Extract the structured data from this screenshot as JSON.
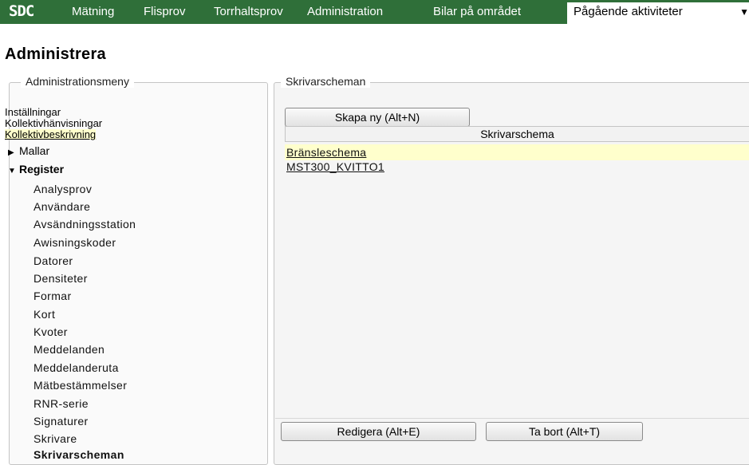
{
  "app": {
    "logo": "SDC"
  },
  "nav": {
    "items": [
      "Mätning",
      "Flisprov",
      "Torrhaltsprov",
      "Administration",
      "Bilar på området"
    ],
    "active": "Pågående aktiviteter"
  },
  "page": {
    "title": "Administrera"
  },
  "left": {
    "legend": "Administrationsmeny",
    "top_items": [
      "Inställningar",
      "Kollektivhänvisningar",
      "Kollektivbeskrivning"
    ],
    "groups": {
      "mallar": "Mallar",
      "register": "Register"
    },
    "register_items": [
      "Analysprov",
      "Användare",
      "Avsändningsstation",
      "Awisningskoder",
      "Datorer",
      "Densiteter",
      "Formar",
      "Kort",
      "Kvoter",
      "Meddelanden",
      "Meddelanderuta",
      "Mätbestämmelser",
      "RNR-serie",
      "Signaturer",
      "Skrivare",
      "Skrivarscheman"
    ]
  },
  "right": {
    "legend": "Skrivarscheman",
    "buttons": {
      "create": "Skapa ny (Alt+N)",
      "edit": "Redigera (Alt+E)",
      "delete": "Ta bort (Alt+T)"
    },
    "table": {
      "header": "Skrivarschema",
      "rows": [
        "Bränsleschema",
        "MST300_KVITTO1"
      ]
    }
  }
}
